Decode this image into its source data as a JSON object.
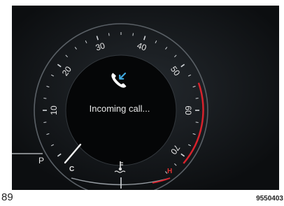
{
  "cluster": {
    "speed_scale": {
      "labels": [
        "10",
        "20",
        "30",
        "40",
        "50",
        "60",
        "70"
      ]
    },
    "notification": {
      "icon": "incoming-call-phone-icon",
      "text": "Incoming call..."
    },
    "temperature_gauge": {
      "cold_label": "C",
      "hot_label": "H",
      "icon": "coolant-temperature-icon"
    },
    "gear_indicator": "P",
    "colors": {
      "redline": "#d8222c",
      "hot_label": "#e03030",
      "call_arrow": "#3fa9e0",
      "background": "#101316"
    }
  },
  "footer": {
    "page_number": "89",
    "figure_code": "9550403"
  }
}
